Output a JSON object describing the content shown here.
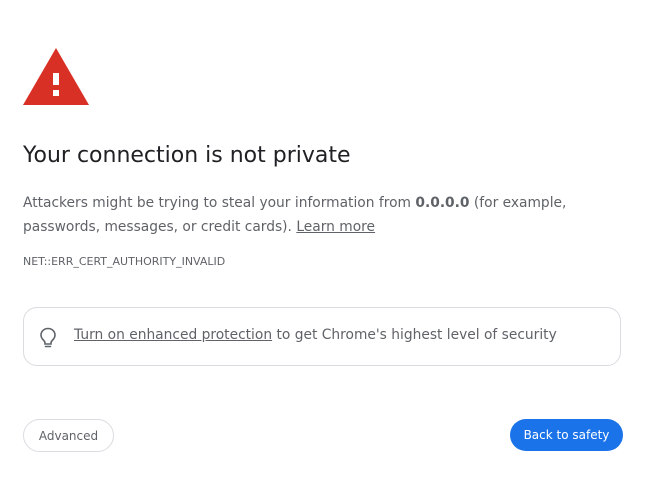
{
  "interstitial": {
    "title": "Your connection is not private",
    "message_prefix": "Attackers might be trying to steal your information from",
    "host": "0.0.0.0",
    "message_suffix": "(for example, passwords, messages, or credit cards).",
    "learn_more": "Learn more",
    "error_code": "NET::ERR_CERT_AUTHORITY_INVALID",
    "enhanced_protection_link": "Turn on enhanced protection",
    "enhanced_protection_text": "to get Chrome's highest level of security",
    "advanced_label": "Advanced",
    "back_to_safety_label": "Back to safety"
  },
  "icons": {
    "warning": "warning-triangle-icon",
    "bulb": "lightbulb-icon"
  },
  "colors": {
    "warning_red": "#d93025",
    "accent_blue": "#1a73e8",
    "secondary_text": "#5f6368",
    "border": "#dadce0"
  }
}
